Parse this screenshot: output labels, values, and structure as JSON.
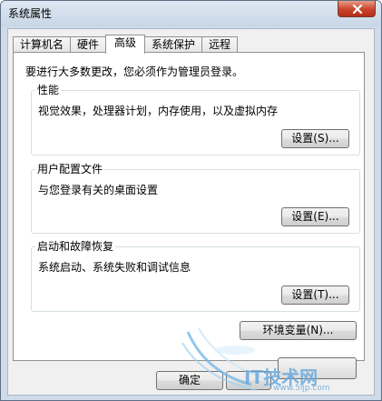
{
  "window": {
    "title": "系统属性"
  },
  "tabs": [
    {
      "label": "计算机名",
      "active": false
    },
    {
      "label": "硬件",
      "active": false
    },
    {
      "label": "高级",
      "active": true
    },
    {
      "label": "系统保护",
      "active": false
    },
    {
      "label": "远程",
      "active": false
    }
  ],
  "advanced": {
    "admin_note": "要进行大多数更改，您必须作为管理员登录。",
    "performance": {
      "label": "性能",
      "description": "视觉效果，处理器计划，内存使用，以及虚拟内存",
      "button": "设置(S)..."
    },
    "user_profiles": {
      "label": "用户配置文件",
      "description": "与您登录有关的桌面设置",
      "button": "设置(E)..."
    },
    "startup_recovery": {
      "label": "启动和故障恢复",
      "description": "系统启动、系统失败和调试信息",
      "button": "设置(T)..."
    },
    "env_button": "环境变量(N)..."
  },
  "footer": {
    "ok_label": "确定"
  },
  "watermark": {
    "text": "IT技术网",
    "url": "www.5ijp.com"
  },
  "colors": {
    "title_bar": "#cfdbe9",
    "close_button": "#c8432b",
    "dialog_background": "#f0f0f0",
    "tab_panel": "#ffffff",
    "group_border": "#d5dfe5"
  }
}
